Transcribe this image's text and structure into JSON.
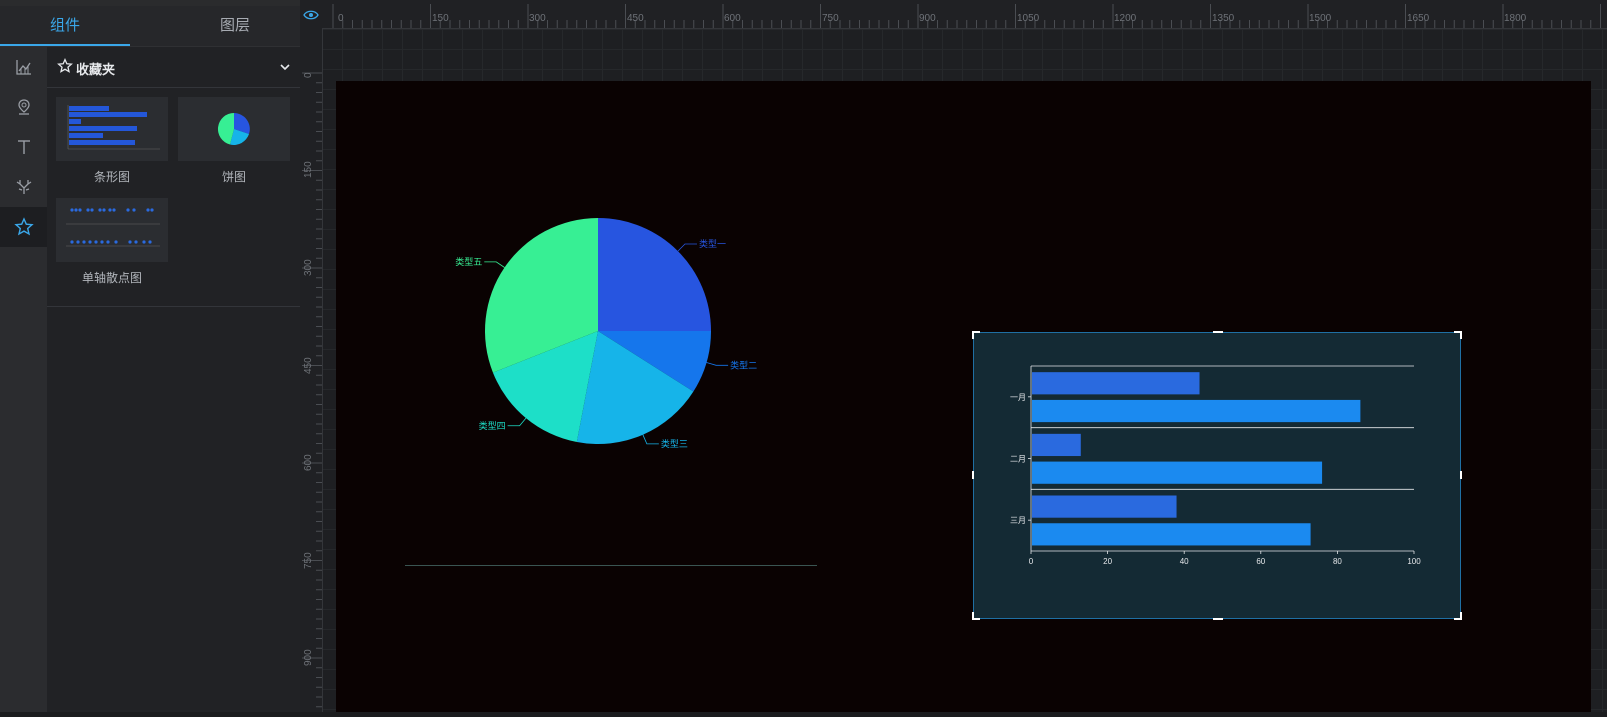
{
  "left_tabs": {
    "components": "组件",
    "layers": "图层"
  },
  "favorites": {
    "title": "收藏夹",
    "items": [
      {
        "label": "条形图",
        "icon": "bar-chart-thumbnail"
      },
      {
        "label": "饼图",
        "icon": "pie-chart-thumbnail"
      },
      {
        "label": "单轴散点图",
        "icon": "single-axis-scatter-thumbnail"
      }
    ]
  },
  "side_icons": [
    "chart-icon",
    "map-pin-icon",
    "text-icon",
    "antler-icon",
    "star-icon"
  ],
  "ruler": {
    "h_ticks": [
      "0",
      "150",
      "300",
      "450",
      "600",
      "750",
      "900",
      "1050",
      "1200",
      "1350",
      "1500",
      "1650",
      "1800"
    ],
    "v_ticks": [
      "0",
      "150",
      "300",
      "450",
      "600",
      "750",
      "900"
    ]
  },
  "chart_data": [
    {
      "type": "pie",
      "slices": [
        {
          "label": "类型一",
          "value": 25,
          "color": "#2755e0"
        },
        {
          "label": "类型二",
          "value": 9,
          "color": "#1576ec"
        },
        {
          "label": "类型三",
          "value": 19,
          "color": "#16b4e9"
        },
        {
          "label": "类型四",
          "value": 16,
          "color": "#1ddfc8"
        },
        {
          "label": "类型五",
          "value": 31,
          "color": "#37ef94"
        }
      ]
    },
    {
      "type": "bar",
      "orientation": "horizontal",
      "categories": [
        "一月",
        "二月",
        "三月"
      ],
      "series": [
        {
          "values": [
            44,
            13,
            38
          ],
          "color": "#2a6adf"
        },
        {
          "values": [
            86,
            76,
            73
          ],
          "color": "#1b8af0"
        }
      ],
      "xlim": [
        0,
        100
      ],
      "x_ticks": [
        "0",
        "20",
        "40",
        "60",
        "80",
        "100"
      ]
    }
  ],
  "colors": {
    "accent": "#3aa7e9",
    "canvas_bg": "#0a0202",
    "bar_panel_bg": "#142a34"
  }
}
